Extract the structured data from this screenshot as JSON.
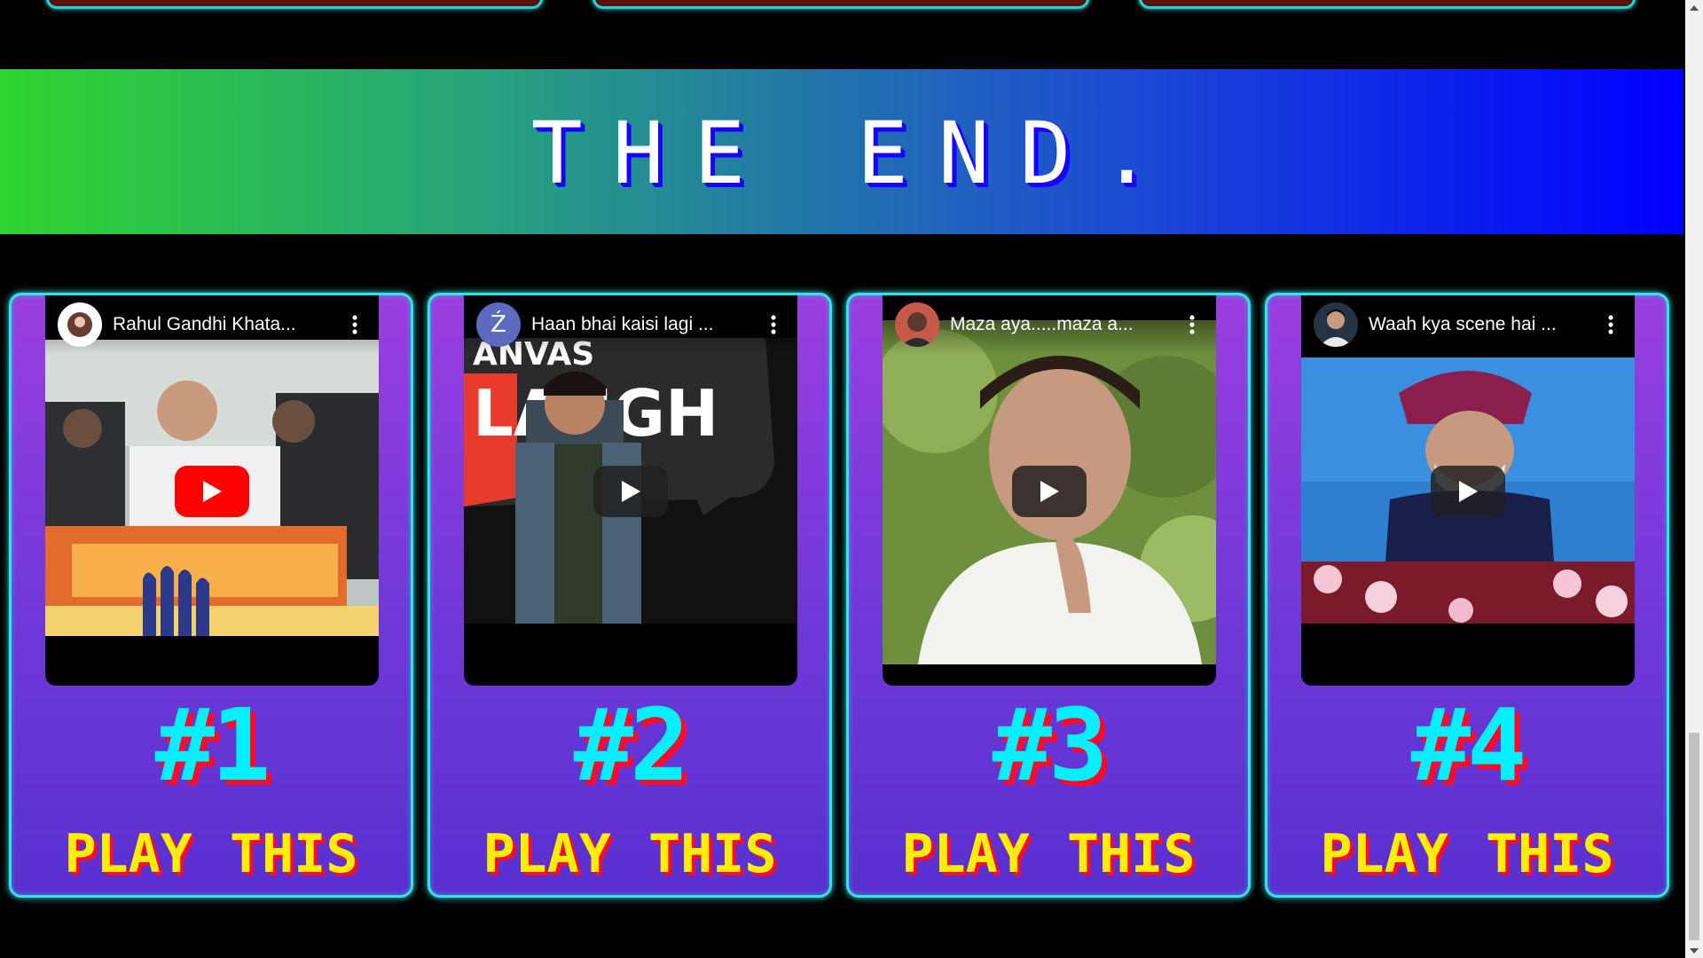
{
  "banner": {
    "title": "THE END."
  },
  "cards": [
    {
      "rank": "#1",
      "play_label": "PLAY THIS",
      "video_title": "Rahul Gandhi Khata...",
      "play_style": "youtube-red",
      "avatar_icon": "channel-avatar-icon"
    },
    {
      "rank": "#2",
      "play_label": "PLAY THIS",
      "video_title": "Haan bhai kaisi lagi ...",
      "avatar_letter": "Ź",
      "play_style": "dark",
      "avatar_icon": "channel-avatar-icon"
    },
    {
      "rank": "#3",
      "play_label": "PLAY THIS",
      "video_title": "Maza aya.....maza a...",
      "play_style": "dark",
      "avatar_icon": "channel-avatar-icon"
    },
    {
      "rank": "#4",
      "play_label": "PLAY THIS",
      "video_title": "Waah kya scene hai ...",
      "play_style": "dark",
      "avatar_icon": "channel-avatar-icon"
    }
  ],
  "colors": {
    "card_border": "#2ee6e6",
    "rank_text": "#00f0ff",
    "play_text": "#ffee00",
    "text_shadow_red": "#ff0a2a",
    "banner_start": "#2ed42e",
    "banner_end": "#0000ff"
  }
}
